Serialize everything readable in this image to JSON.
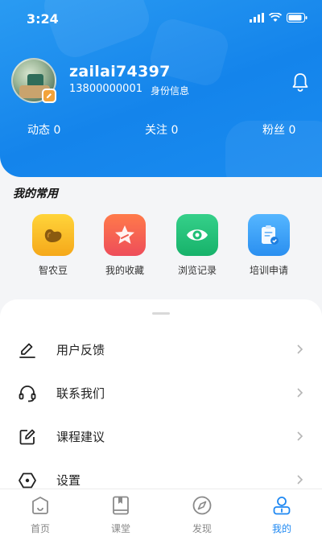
{
  "status": {
    "time": "3:24"
  },
  "profile": {
    "username": "zailai74397",
    "phone": "13800000001",
    "id_info": "身份信息"
  },
  "stats": [
    {
      "label": "动态",
      "value": "0"
    },
    {
      "label": "关注",
      "value": "0"
    },
    {
      "label": "粉丝",
      "value": "0"
    }
  ],
  "common": {
    "title": "我的常用",
    "items": [
      {
        "label": "智农豆",
        "icon": "bean-icon",
        "color": "#f7b81c"
      },
      {
        "label": "我的收藏",
        "icon": "star-icon",
        "color": "#f35e4a"
      },
      {
        "label": "浏览记录",
        "icon": "eye-icon",
        "color": "#26c47c"
      },
      {
        "label": "培训申请",
        "icon": "clipboard-check-icon",
        "color": "#3aa0f5"
      }
    ]
  },
  "menu": [
    {
      "label": "用户反馈",
      "icon": "edit-pen-icon"
    },
    {
      "label": "联系我们",
      "icon": "headset-icon"
    },
    {
      "label": "课程建议",
      "icon": "edit-square-icon"
    },
    {
      "label": "设置",
      "icon": "settings-hex-icon"
    }
  ],
  "tabs": [
    {
      "label": "首页",
      "icon": "home-icon",
      "active": false
    },
    {
      "label": "课堂",
      "icon": "book-icon",
      "active": false
    },
    {
      "label": "发现",
      "icon": "compass-icon",
      "active": false
    },
    {
      "label": "我的",
      "icon": "user-icon",
      "active": true
    }
  ],
  "colors": {
    "primary": "#1e88f2",
    "header": "#1484eb"
  }
}
